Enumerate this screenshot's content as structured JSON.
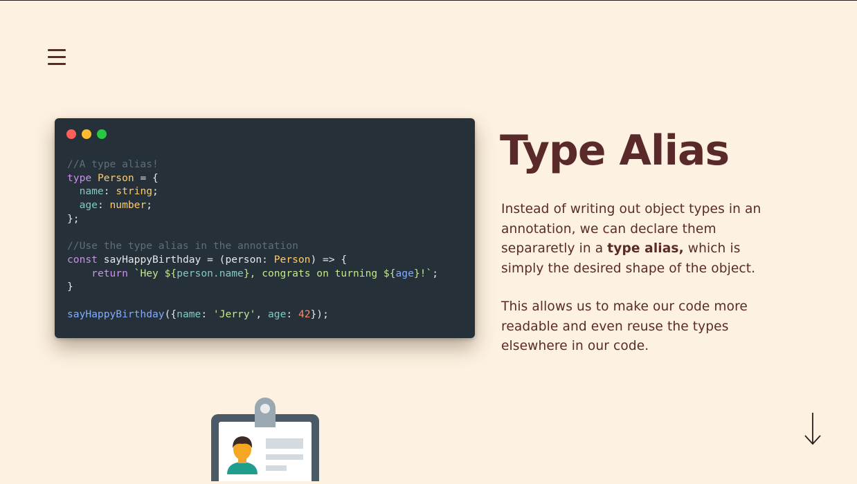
{
  "header": {
    "menu_icon": "hamburger-menu-icon"
  },
  "code_window": {
    "window_dots": {
      "close_color": "#ff5f57",
      "minimize_color": "#febc2e",
      "maximize_color": "#28c840"
    },
    "code": {
      "comment1": "//A type alias!",
      "kw_type": "type",
      "type_name": "Person",
      "eq_open": " = {",
      "prop_name": "name",
      "colon1": ": ",
      "type_string": "string",
      "semi1": ";",
      "prop_age": "age",
      "colon2": ": ",
      "type_number": "number",
      "semi2": ";",
      "close_brace_semi": "};",
      "comment2": "//Use the type alias in the annotation",
      "kw_const": "const",
      "fn_decl": " sayHappyBirthday = (person: ",
      "param_type": "Person",
      "arrow_open": ") => {",
      "kw_return": "return",
      "tpl_start": "`Hey ${",
      "tpl_expr1": "person.name",
      "tpl_mid": "}, congrats on turning ${",
      "tpl_expr2": "age",
      "tpl_end": "}!`",
      "semi3": ";",
      "close_brace": "}",
      "call_fn": "sayHappyBirthday",
      "call_open": "({",
      "call_key_name": "name",
      "colon3": ": ",
      "call_val_name": "'Jerry'",
      "comma": ", ",
      "call_key_age": "age",
      "colon4": ": ",
      "call_val_age": "42",
      "call_close": "});"
    }
  },
  "content": {
    "title": "Type Alias",
    "paragraph1": {
      "before": "Instead of writing out object types in an annotation, we can declare them separaretly in a ",
      "bold": "type alias,",
      "after": " which is simply the desired shape of the object."
    },
    "paragraph2": "This allows us to make our code more readable and even reuse the types elsewhere in our code."
  },
  "footer": {
    "scroll_icon": "arrow-down-icon",
    "illustration_icon": "id-badge-icon"
  },
  "colors": {
    "background": "#fdf1e1",
    "text_primary": "#5a2a2a",
    "code_background": "#263038",
    "syntax_comment": "#5f6f7a",
    "syntax_keyword": "#c792ea",
    "syntax_type": "#ffcb6b",
    "syntax_property": "#80cbc4",
    "syntax_string": "#c3e88d",
    "syntax_function": "#82aaff",
    "syntax_number": "#f78c6c"
  }
}
